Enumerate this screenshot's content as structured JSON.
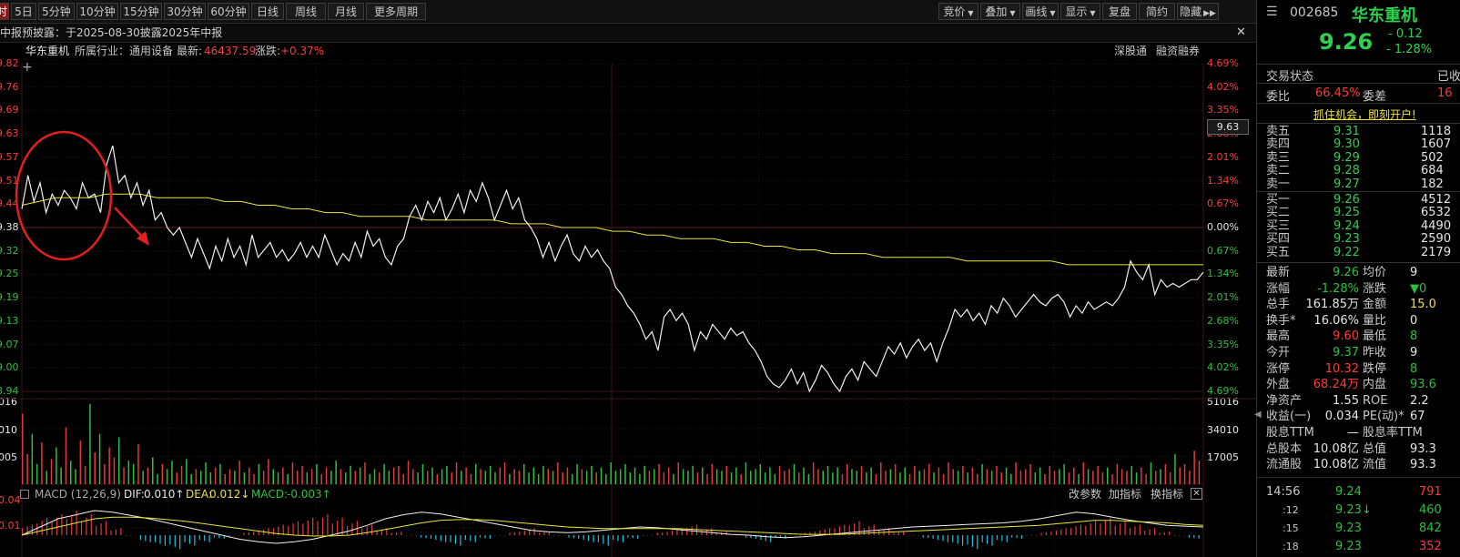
{
  "toolbar": {
    "items": [
      "时",
      "5日",
      "5分钟",
      "10分钟",
      "15分钟",
      "30分钟",
      "60分钟",
      "日线",
      "周线",
      "月线",
      "更多周期"
    ],
    "right_items": [
      "竞价",
      "叠加",
      "画线",
      "显示",
      "复盘",
      "简约",
      "隐藏"
    ]
  },
  "notice": {
    "text": "中报预披露：于2025-08-30披露2025年中报"
  },
  "info": {
    "name": "华东重机",
    "industry": "所属行业：通用设备",
    "latest_label": "最新:",
    "latest_value": "46437.59",
    "change_label": "涨跌:",
    "change_value": "+0.37%",
    "link1": "深股通",
    "link2": "融资融券"
  },
  "price_axis_left": [
    "9.82",
    "9.76",
    "9.69",
    "9.63",
    "9.57",
    "9.51",
    "9.44",
    "9.38",
    "9.32",
    "9.25",
    "9.19",
    "9.13",
    "9.07",
    "9.00",
    "8.94"
  ],
  "price_axis_right": [
    "4.69%",
    "4.02%",
    "3.35%",
    "2.68%",
    "2.01%",
    "1.34%",
    "0.67%",
    "0.00%",
    "0.67%",
    "1.34%",
    "2.01%",
    "2.68%",
    "3.35%",
    "4.02%",
    "4.69%"
  ],
  "cursor_price": "9.63",
  "volume_axis_left": [
    "016",
    "010",
    "005"
  ],
  "volume_axis_right": [
    "51016",
    "34010",
    "17005"
  ],
  "macd_axis_left": [
    "0.04",
    "0.01"
  ],
  "macd": {
    "label": "MACD (12,26,9)",
    "dif_label": "DIF:",
    "dif": "0.010↑",
    "dea_label": "DEA:",
    "dea": "0.012↓",
    "macd_label": "MACD:",
    "macd": "-0.003↑",
    "buttons": [
      "改参数",
      "加指标",
      "换指标"
    ]
  },
  "chart_data": {
    "type": "line",
    "title": "",
    "prev_close": 9.38,
    "ylim": [
      8.94,
      9.82
    ],
    "price": [
      9.43,
      9.52,
      9.45,
      9.5,
      9.42,
      9.47,
      9.44,
      9.48,
      9.46,
      9.43,
      9.5,
      9.46,
      9.47,
      9.42,
      9.55,
      9.6,
      9.5,
      9.52,
      9.46,
      9.5,
      9.44,
      9.48,
      9.4,
      9.42,
      9.38,
      9.36,
      9.38,
      9.34,
      9.3,
      9.35,
      9.31,
      9.27,
      9.33,
      9.29,
      9.35,
      9.3,
      9.33,
      9.28,
      9.36,
      9.3,
      9.32,
      9.34,
      9.3,
      9.32,
      9.29,
      9.31,
      9.34,
      9.3,
      9.33,
      9.3,
      9.36,
      9.32,
      9.28,
      9.31,
      9.29,
      9.34,
      9.3,
      9.37,
      9.33,
      9.35,
      9.3,
      9.28,
      9.33,
      9.35,
      9.41,
      9.44,
      9.4,
      9.45,
      9.42,
      9.46,
      9.4,
      9.43,
      9.47,
      9.42,
      9.48,
      9.45,
      9.5,
      9.46,
      9.4,
      9.44,
      9.48,
      9.43,
      9.46,
      9.4,
      9.38,
      9.35,
      9.3,
      9.34,
      9.29,
      9.33,
      9.36,
      9.31,
      9.29,
      9.33,
      9.3,
      9.32,
      9.29,
      9.27,
      9.22,
      9.2,
      9.17,
      9.15,
      9.12,
      9.08,
      9.1,
      9.05,
      9.14,
      9.16,
      9.13,
      9.15,
      9.12,
      9.05,
      9.1,
      9.08,
      9.12,
      9.1,
      9.08,
      9.11,
      9.09,
      9.1,
      9.07,
      9.05,
      9.02,
      8.98,
      8.96,
      8.95,
      8.97,
      9.0,
      8.96,
      8.99,
      8.94,
      8.97,
      9.01,
      8.99,
      8.96,
      8.94,
      8.98,
      9.0,
      8.97,
      9.02,
      9.0,
      8.98,
      9.02,
      9.06,
      9.04,
      9.07,
      9.03,
      9.06,
      9.08,
      9.05,
      9.07,
      9.02,
      9.07,
      9.11,
      9.16,
      9.14,
      9.16,
      9.13,
      9.15,
      9.12,
      9.17,
      9.15,
      9.19,
      9.17,
      9.14,
      9.16,
      9.18,
      9.2,
      9.18,
      9.17,
      9.19,
      9.2,
      9.18,
      9.14,
      9.17,
      9.15,
      9.18,
      9.16,
      9.17,
      9.18,
      9.17,
      9.19,
      9.22,
      9.29,
      9.26,
      9.24,
      9.28,
      9.2,
      9.24,
      9.22,
      9.23,
      9.22,
      9.23,
      9.24,
      9.24,
      9.26
    ],
    "avg_price": [
      9.44,
      9.45,
      9.46,
      9.46,
      9.46,
      9.47,
      9.47,
      9.47,
      9.46,
      9.46,
      9.46,
      9.46,
      9.45,
      9.45,
      9.44,
      9.44,
      9.43,
      9.43,
      9.42,
      9.42,
      9.41,
      9.41,
      9.41,
      9.41,
      9.4,
      9.4,
      9.4,
      9.4,
      9.4,
      9.39,
      9.39,
      9.39,
      9.38,
      9.38,
      9.38,
      9.37,
      9.37,
      9.36,
      9.36,
      9.35,
      9.35,
      9.35,
      9.34,
      9.34,
      9.33,
      9.33,
      9.32,
      9.32,
      9.31,
      9.31,
      9.31,
      9.3,
      9.3,
      9.3,
      9.3,
      9.3,
      9.29,
      9.29,
      9.29,
      9.29,
      9.29,
      9.29,
      9.28,
      9.28,
      9.28,
      9.28,
      9.28,
      9.28,
      9.28,
      9.28,
      9.28
    ],
    "volume": [
      42,
      18,
      30,
      12,
      25,
      8,
      15,
      22,
      10,
      34,
      14,
      9,
      26,
      11,
      48,
      19,
      30,
      12,
      22,
      16,
      28,
      10,
      14,
      12,
      24,
      8,
      10,
      16,
      6,
      12,
      9,
      14,
      7,
      11,
      15,
      6,
      9,
      8,
      13,
      7,
      10,
      12,
      6,
      9,
      8,
      14,
      7,
      10,
      6,
      12,
      8,
      15,
      9,
      7,
      10,
      6,
      13,
      8,
      11,
      7,
      9,
      12,
      6,
      10,
      8,
      14,
      9,
      7,
      11,
      8,
      10,
      13,
      6,
      9,
      7,
      12,
      8,
      10,
      11,
      6,
      14,
      9,
      7,
      12,
      8,
      10,
      6,
      9,
      11,
      7,
      13,
      8,
      10,
      6,
      12,
      9,
      8,
      11,
      7,
      10,
      13,
      6,
      9,
      8,
      12,
      7,
      10,
      6,
      11,
      9,
      8,
      13,
      7,
      10,
      6,
      12,
      9,
      8,
      11,
      7,
      10,
      6,
      13,
      8,
      9,
      12,
      7,
      10,
      6,
      11,
      8,
      9,
      12,
      7,
      10,
      6,
      13,
      9,
      8,
      11,
      7,
      10,
      6,
      12,
      9,
      8,
      11,
      7,
      10,
      6,
      13,
      8,
      9,
      12,
      7,
      10,
      6,
      11,
      8,
      9,
      12,
      7,
      10,
      6,
      13,
      9,
      8,
      11,
      7,
      10,
      6,
      12,
      9,
      8,
      11,
      7,
      10,
      6,
      13,
      8,
      9,
      12,
      7,
      10,
      6,
      11,
      8,
      9,
      12,
      7,
      10,
      6,
      13,
      9,
      8,
      11,
      7,
      10,
      6,
      12,
      9,
      8,
      11,
      7,
      10,
      6,
      13,
      8,
      9,
      12,
      7,
      10,
      6,
      11,
      8,
      9,
      12,
      7,
      10,
      6,
      13,
      9,
      8,
      11,
      7,
      10,
      6,
      12,
      9,
      8,
      11,
      7,
      10,
      6,
      13,
      8,
      9,
      12,
      7,
      18,
      10,
      12,
      8,
      20,
      14
    ],
    "macd_hist": [
      3,
      5,
      6,
      7,
      6,
      4,
      2,
      0,
      -2,
      -3,
      -4,
      -3,
      -2,
      -1,
      0,
      1,
      2,
      3,
      4,
      5,
      6,
      5,
      4,
      3,
      2,
      1,
      0,
      -1,
      -2,
      -3,
      -2,
      -1,
      0,
      1,
      2,
      1,
      0,
      -1,
      -2,
      -3,
      -2,
      -1,
      0,
      1,
      2,
      3,
      2,
      1,
      0,
      -1,
      -2,
      -1,
      0,
      1,
      2,
      3,
      4,
      3,
      2,
      1,
      0,
      -1,
      -2,
      -3,
      -4,
      -3,
      -2,
      -1,
      0,
      1,
      2,
      3,
      4,
      5,
      4,
      3,
      2,
      1,
      0,
      -1
    ],
    "dif": [
      0.0,
      0.01,
      0.02,
      0.025,
      0.03,
      0.028,
      0.024,
      0.02,
      0.015,
      0.01,
      0.005,
      0.0,
      -0.005,
      -0.008,
      -0.01,
      -0.008,
      -0.005,
      0.0,
      0.005,
      0.012,
      0.02,
      0.025,
      0.028,
      0.026,
      0.022,
      0.018,
      0.014,
      0.01,
      0.006,
      0.004,
      0.003,
      0.004,
      0.006,
      0.008,
      0.01,
      0.009,
      0.007,
      0.005,
      0.003,
      0.001,
      0.0,
      -0.002,
      -0.003,
      -0.002,
      0.0,
      0.002,
      0.004,
      0.006,
      0.008,
      0.01,
      0.011,
      0.012,
      0.013,
      0.014,
      0.015,
      0.017,
      0.02,
      0.024,
      0.028,
      0.026,
      0.022,
      0.018,
      0.015,
      0.012,
      0.011,
      0.01
    ],
    "dea": [
      0.0,
      0.005,
      0.01,
      0.015,
      0.02,
      0.022,
      0.022,
      0.021,
      0.019,
      0.017,
      0.014,
      0.011,
      0.008,
      0.005,
      0.002,
      0.0,
      -0.001,
      -0.001,
      0.0,
      0.003,
      0.007,
      0.011,
      0.015,
      0.018,
      0.019,
      0.019,
      0.018,
      0.016,
      0.014,
      0.012,
      0.01,
      0.009,
      0.008,
      0.008,
      0.008,
      0.008,
      0.008,
      0.007,
      0.006,
      0.005,
      0.004,
      0.003,
      0.002,
      0.001,
      0.001,
      0.001,
      0.002,
      0.003,
      0.004,
      0.005,
      0.006,
      0.007,
      0.008,
      0.009,
      0.01,
      0.011,
      0.012,
      0.014,
      0.016,
      0.018,
      0.018,
      0.017,
      0.016,
      0.015,
      0.013,
      0.012
    ]
  },
  "panel": {
    "code": "002685",
    "name": "华东重机",
    "price": "9.26",
    "change": "- 0.12",
    "change_pct": "- 1.28%",
    "trade_status_label": "交易状态",
    "trade_status_value": "已收",
    "weibi_label": "委比",
    "weibi_value": "66.45%",
    "weicha_label": "委差",
    "weicha_value": "16",
    "promo": "抓住机会，即刻开户!",
    "asks": [
      {
        "label": "卖五",
        "price": "9.31",
        "vol": "1118"
      },
      {
        "label": "卖四",
        "price": "9.30",
        "vol": "1607"
      },
      {
        "label": "卖三",
        "price": "9.29",
        "vol": "502"
      },
      {
        "label": "卖二",
        "price": "9.28",
        "vol": "684"
      },
      {
        "label": "卖一",
        "price": "9.27",
        "vol": "182"
      }
    ],
    "bids": [
      {
        "label": "买一",
        "price": "9.26",
        "vol": "4512"
      },
      {
        "label": "买二",
        "price": "9.25",
        "vol": "6532"
      },
      {
        "label": "买三",
        "price": "9.24",
        "vol": "4490"
      },
      {
        "label": "买四",
        "price": "9.23",
        "vol": "2590"
      },
      {
        "label": "买五",
        "price": "9.22",
        "vol": "2179"
      }
    ],
    "stats": [
      {
        "l1": "最新",
        "v1": "9.26",
        "c1": "green",
        "l2": "均价",
        "v2": "9",
        "c2": "white"
      },
      {
        "l1": "涨幅",
        "v1": "-1.28%",
        "c1": "green",
        "l2": "涨跌",
        "v2": "▼0",
        "c2": "green"
      },
      {
        "l1": "总手",
        "v1": "161.85万",
        "c1": "white",
        "l2": "金额",
        "v2": "15.0",
        "c2": "yellow"
      },
      {
        "l1": "换手*",
        "v1": "16.06%",
        "c1": "white",
        "l2": "量比",
        "v2": "0",
        "c2": "white"
      },
      {
        "l1": "最高",
        "v1": "9.60",
        "c1": "red",
        "l2": "最低",
        "v2": "8",
        "c2": "green"
      },
      {
        "l1": "今开",
        "v1": "9.37",
        "c1": "green",
        "l2": "昨收",
        "v2": "9",
        "c2": "white"
      },
      {
        "l1": "涨停",
        "v1": "10.32",
        "c1": "red",
        "l2": "跌停",
        "v2": "8",
        "c2": "green"
      },
      {
        "l1": "外盘",
        "v1": "68.24万",
        "c1": "red",
        "l2": "内盘",
        "v2": "93.6",
        "c2": "green"
      },
      {
        "l1": "净资产",
        "v1": "1.55",
        "c1": "white",
        "l2": "ROE",
        "v2": "2.2",
        "c2": "white"
      },
      {
        "l1": "收益(一)",
        "v1": "0.034",
        "c1": "white",
        "l2": "PE(动)*",
        "v2": "67",
        "c2": "white"
      },
      {
        "l1": "股息TTM",
        "v1": "—",
        "c1": "white",
        "l2": "股息率TTM",
        "v2": "",
        "c2": "white"
      },
      {
        "l1": "总股本",
        "v1": "10.08亿",
        "c1": "white",
        "l2": "总值",
        "v2": "93.3",
        "c2": "white"
      },
      {
        "l1": "流通股",
        "v1": "10.08亿",
        "c1": "white",
        "l2": "流值",
        "v2": "93.3",
        "c2": "white"
      }
    ],
    "ticks": [
      {
        "time": "14:56",
        "price": "9.24",
        "vol": "791",
        "vc": "red"
      },
      {
        "time": ":12",
        "price": "9.23↓",
        "vol": "460",
        "vc": "green"
      },
      {
        "time": ":15",
        "price": "9.23",
        "vol": "842",
        "vc": "green"
      },
      {
        "time": ":18",
        "price": "9.23",
        "vol": "352",
        "vc": "red"
      }
    ]
  }
}
